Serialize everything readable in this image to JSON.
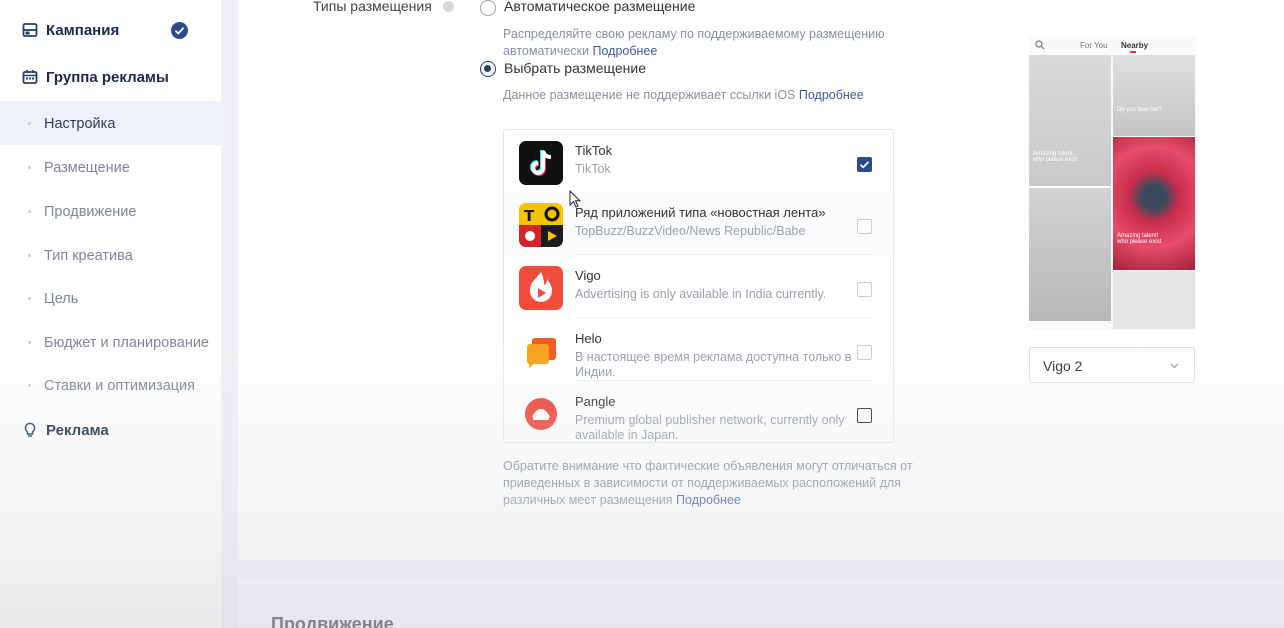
{
  "sidebar": {
    "campaign": "Кампания",
    "ad_group": "Группа рекламы",
    "items": [
      {
        "label": "Настройка"
      },
      {
        "label": "Размещение"
      },
      {
        "label": "Продвижение"
      },
      {
        "label": "Тип креатива"
      },
      {
        "label": "Цель"
      },
      {
        "label": "Бюджет и планирование"
      },
      {
        "label": "Ставки и оптимизация"
      }
    ],
    "ad": "Реклама"
  },
  "placement": {
    "types_label": "Типы размещения",
    "auto_option": "Автоматическое размещение",
    "auto_desc_line1": "Распределяйте свою рекламу по поддерживаемому размещению",
    "auto_desc_line2": "автоматически",
    "more_link": "Подробнее",
    "select_option": "Выбрать размещение",
    "select_desc": "Данное размещение не поддерживает ссылки iOS",
    "apps": [
      {
        "name": "TikTok",
        "desc": "TikTok",
        "checked": true
      },
      {
        "name": "Ряд приложений типа «новостная лента»",
        "desc": "TopBuzz/BuzzVideo/News Republic/Babe",
        "checked": false
      },
      {
        "name": "Vigo",
        "desc": "Advertising is only available in India currently.",
        "checked": false
      },
      {
        "name": "Helo",
        "desc": "В настоящее время реклама доступна только в Индии.",
        "checked": false
      },
      {
        "name": "Pangle",
        "desc": "Premium global publisher network, currently only available in Japan.",
        "checked": false
      }
    ],
    "note_line1": "Обратите внимание что фактические объявления могут отличаться от",
    "note_line2": "приведенных в зависимости от поддерживаемых расположений для",
    "note_line3": "различных мест размещения"
  },
  "preview": {
    "tab_for_you": "For You",
    "tab_nearby": "Nearby",
    "tile_text_1": "Do you love me?",
    "tile_text_2": "Amazing talent,\nwho please exist",
    "tile_text_3": "Amazing talent!\nwho please exist",
    "dropdown_value": "Vigo  2"
  },
  "next_section": {
    "title": "Продвижение"
  },
  "colors": {
    "accent": "#2c4a8c",
    "link": "#3e5b9a"
  }
}
